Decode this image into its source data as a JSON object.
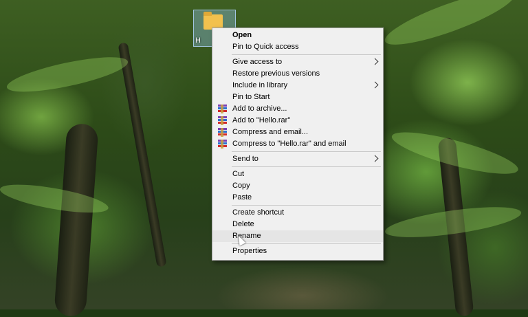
{
  "desktop": {
    "icon_label": "H"
  },
  "menu": {
    "groups": [
      [
        {
          "label": "Open",
          "bold": true
        },
        {
          "label": "Pin to Quick access"
        }
      ],
      [
        {
          "label": "Give access to",
          "submenu": true
        },
        {
          "label": "Restore previous versions"
        },
        {
          "label": "Include in library",
          "submenu": true
        },
        {
          "label": "Pin to Start"
        },
        {
          "label": "Add to archive...",
          "icon": "winrar-icon"
        },
        {
          "label": "Add to \"Hello.rar\"",
          "icon": "winrar-icon"
        },
        {
          "label": "Compress and email...",
          "icon": "winrar-icon"
        },
        {
          "label": "Compress to \"Hello.rar\" and email",
          "icon": "winrar-icon"
        }
      ],
      [
        {
          "label": "Send to",
          "submenu": true
        }
      ],
      [
        {
          "label": "Cut"
        },
        {
          "label": "Copy"
        },
        {
          "label": "Paste"
        }
      ],
      [
        {
          "label": "Create shortcut"
        },
        {
          "label": "Delete"
        },
        {
          "label": "Rename",
          "hover": true
        }
      ],
      [
        {
          "label": "Properties"
        }
      ]
    ]
  },
  "colors": {
    "menu_bg": "#f0f0f0",
    "menu_border": "#a0a0a0",
    "hover_bg": "#e5e5e5",
    "separator": "#c8c8c8"
  }
}
